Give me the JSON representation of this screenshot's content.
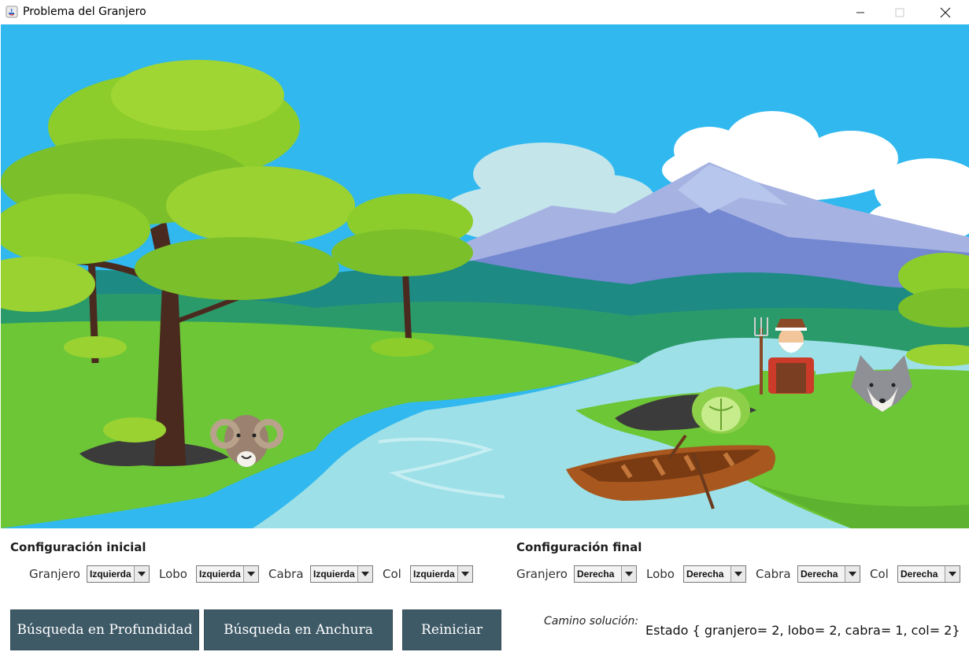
{
  "window": {
    "title": "Problema del Granjero"
  },
  "scene": {
    "description_icons": [
      "tree-icon",
      "ram-icon",
      "farmer-icon",
      "wolf-icon",
      "cabbage-icon",
      "boat-icon"
    ]
  },
  "initial": {
    "title": "Configuración inicial",
    "fields": [
      {
        "label": "Granjero",
        "value": "Izquierda"
      },
      {
        "label": "Lobo",
        "value": "Izquierda"
      },
      {
        "label": "Cabra",
        "value": "Izquierda"
      },
      {
        "label": "Col",
        "value": "Izquierda"
      }
    ]
  },
  "final": {
    "title": "Configuración final",
    "fields": [
      {
        "label": "Granjero",
        "value": "Derecha"
      },
      {
        "label": "Lobo",
        "value": "Derecha"
      },
      {
        "label": "Cabra",
        "value": "Derecha"
      },
      {
        "label": "Col",
        "value": "Derecha"
      }
    ]
  },
  "buttons": {
    "depth": "Búsqueda en Profundidad",
    "breadth": "Búsqueda en Anchura",
    "reset": "Reiniciar"
  },
  "solution": {
    "label": "Camino solución:",
    "state": "Estado { granjero= 2, lobo= 2, cabra= 1, col= 2}"
  },
  "colors": {
    "sky": "#30b8ef",
    "water": "#9de0e8",
    "grass": "#6cc636",
    "button": "#3f5a67"
  }
}
